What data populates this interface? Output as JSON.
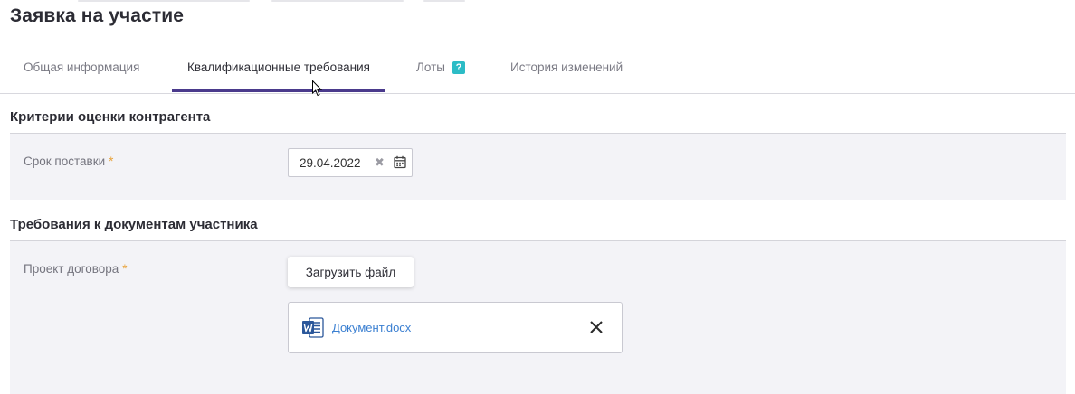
{
  "header": {
    "title": "Заявка на участие"
  },
  "tabs": [
    {
      "label": "Общая информация",
      "active": false
    },
    {
      "label": "Квалификационные требования",
      "active": true
    },
    {
      "label": "Лоты",
      "active": false,
      "badge": "?"
    },
    {
      "label": "История изменений",
      "active": false
    }
  ],
  "section_criteria": {
    "title": "Критерии оценки контрагента",
    "delivery": {
      "label": "Срок поставки",
      "required_mark": "*",
      "value": "29.04.2022"
    }
  },
  "section_documents": {
    "title": "Требования к документам участника",
    "contract": {
      "label": "Проект договора",
      "required_mark": "*",
      "upload_label": "Загрузить файл",
      "file": {
        "name": "Документ.docx",
        "icon": "word-file-icon"
      }
    }
  },
  "colors": {
    "accent": "#4a3a8c",
    "badge": "#2cbcc6",
    "link": "#3a7fd1",
    "required": "#e8a33c",
    "panel": "#f3f3f7"
  }
}
